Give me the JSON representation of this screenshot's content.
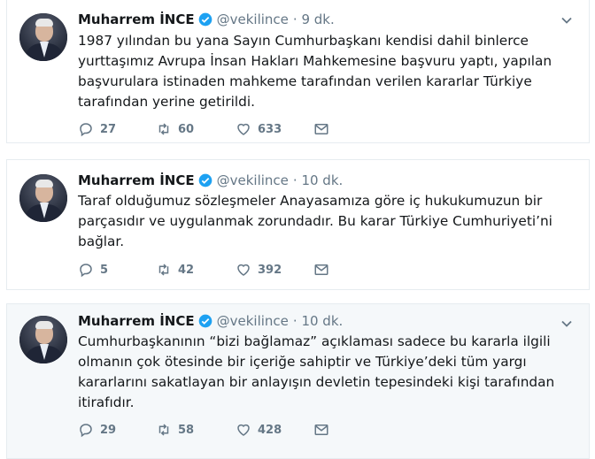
{
  "tweets": [
    {
      "name": "Muharrem İNCE",
      "handle": "@vekilince",
      "time": "· 9 dk.",
      "text": "1987 yılından bu yana Sayın Cumhurbaşkanı kendisi dahil binlerce yurttaşımız Avrupa İnsan Hakları Mahkemesine başvuru yaptı, yapılan başvurulara istinaden mahkeme tarafından verilen kararlar Türkiye tarafından yerine getirildi.",
      "replies": "27",
      "retweets": "60",
      "likes": "633"
    },
    {
      "name": "Muharrem İNCE",
      "handle": "@vekilince",
      "time": "· 10 dk.",
      "text": "Taraf olduğumuz sözleşmeler Anayasamıza göre iç hukukumuzun bir parçasıdır ve uygulanmak zorundadır. Bu karar Türkiye Cumhuriyeti’ni bağlar.",
      "replies": "5",
      "retweets": "42",
      "likes": "392"
    },
    {
      "name": "Muharrem İNCE",
      "handle": "@vekilince",
      "time": "· 10 dk.",
      "text": "Cumhurbaşkanının “bizi bağlamaz” açıklaması sadece bu kararla ilgili olmanın çok ötesinde bir içeriğe sahiptir ve Türkiye’deki tüm yargı kararlarını sakatlayan bir anlayışın devletin tepesindeki kişi tarafından itirafıdır.",
      "replies": "29",
      "retweets": "58",
      "likes": "428"
    }
  ],
  "icons": {
    "reply": "reply-icon",
    "retweet": "retweet-icon",
    "like": "heart-icon",
    "message": "envelope-icon",
    "verified": "verified-badge-icon",
    "more": "chevron-down-icon"
  },
  "colors": {
    "verified": "#1da1f2",
    "text": "#14171a",
    "muted": "#657786",
    "highlight_bg": "#f5f8fa"
  }
}
